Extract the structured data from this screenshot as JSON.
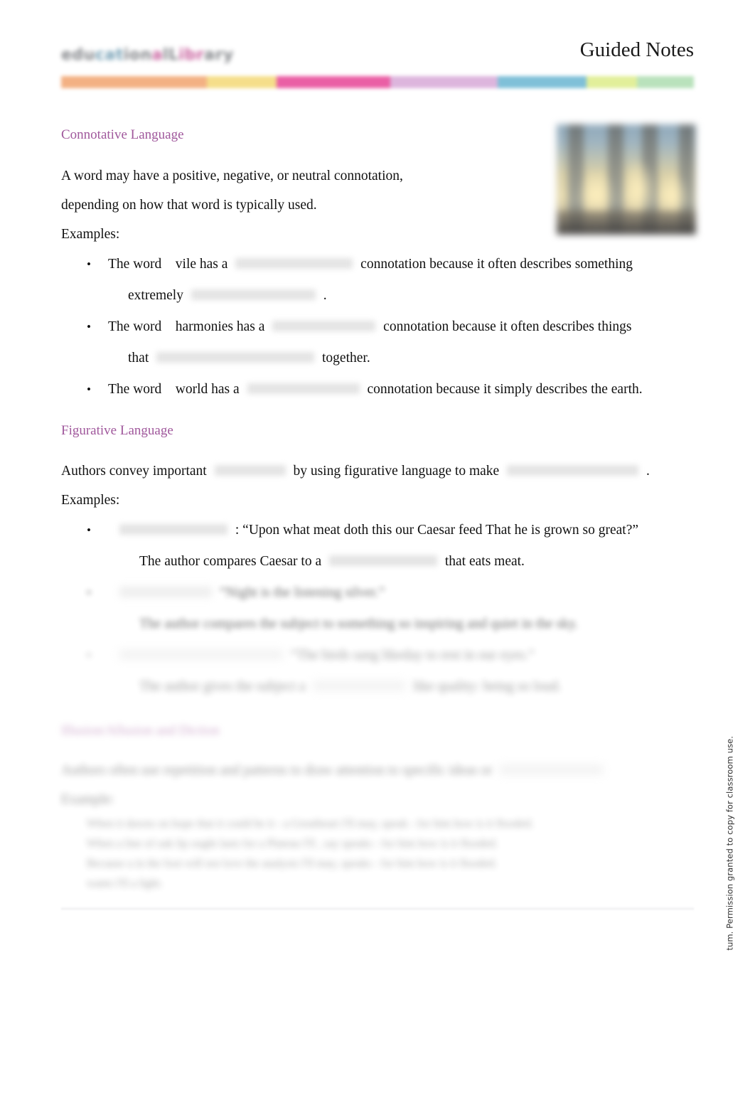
{
  "header": {
    "logo_text_parts": [
      "edu",
      "cat",
      "ion",
      "alL",
      "ibr",
      "ary"
    ],
    "logo_alt": "publisher-logo",
    "document_title": "Guided Notes",
    "colorbar": [
      {
        "name": "orange",
        "hex": "#f3b183",
        "width": 23
      },
      {
        "name": "yellow",
        "hex": "#f5de8a",
        "width": 11
      },
      {
        "name": "magenta",
        "hex": "#ea5fa5",
        "width": 18
      },
      {
        "name": "lavender",
        "hex": "#ddb5dd",
        "width": 17
      },
      {
        "name": "blue",
        "hex": "#7fc0d8",
        "width": 14
      },
      {
        "name": "lime",
        "hex": "#e2ef9a",
        "width": 8
      },
      {
        "name": "green",
        "hex": "#b9e2bc",
        "width": 9
      }
    ]
  },
  "hero_image": {
    "name": "columns-photo",
    "description": "Blurred photograph of classical stone columns against a blue sky with warm golden light"
  },
  "sections": [
    {
      "heading": "Connotative Language",
      "intro_line1": "A word may have a positive, negative, or neutral connotation,",
      "intro_line2": "depending on how that word is typically used.",
      "examples_label": "Examples:",
      "bullets": [
        {
          "part1": "The word",
          "word": "vile has a",
          "blank1_width": 165,
          "part2": "connotation because it often describes something",
          "cont_part1": "extremely",
          "blank2_width": 175,
          "cont_part2": "."
        },
        {
          "part1": "The word",
          "word": "harmonies   has a",
          "blank1_width": 145,
          "part2": "connotation because it often describes things",
          "cont_part1": "that",
          "blank2_width": 222,
          "cont_part2": "together."
        },
        {
          "part1": "The word",
          "word": "world  has a",
          "blank1_width": 158,
          "part2": "connotation because it simply describes the earth.",
          "cont_part1": "",
          "blank2_width": 0,
          "cont_part2": ""
        }
      ]
    },
    {
      "heading": "Figurative Language",
      "intro_part1": "Authors convey important",
      "intro_blank1_width": 100,
      "intro_part2": "by using figurative language to make",
      "intro_blank2_width": 185,
      "intro_part3": ".",
      "examples_label": "Examples:",
      "bullets": [
        {
          "blank_lead_width": 152,
          "text": ": “Upon what meat doth this our Caesar feed That he is grown so great?”",
          "cont_part1": "The author compares Caesar to a",
          "cont_blank_width": 152,
          "cont_part2": "that eats meat."
        },
        {
          "obscured": true,
          "blank_lead_width": 130,
          "text": "“Night is the listening silver.”",
          "cont_text": "The author compares the subject to something so inspiring and quiet in the sky."
        },
        {
          "obscured": true,
          "blank_lead_width": 230,
          "text": "“The birds sang likeday to rest in our eyes.”",
          "cont_part1": "The author gives the subject a",
          "cont_blank_width": 130,
          "cont_part2": "like quality: being so loud."
        }
      ]
    },
    {
      "obscured": true,
      "heading": "Illusion/Allusion and Diction",
      "intro_text": "Authors often use repetition and patterns to draw attention to specific ideas or",
      "intro_blank_width": 145,
      "examples_label": "Example:",
      "lines": [
        "When it dawns on hope that it could be it       - a Greatheart I'll may, speak   - for him how is it flooded.",
        "When a line of oak lip ought lasts for a Plateau I'll       ,  say   speaks   - for him how is it flooded.",
        "Because a    in the foot will not love the    analysis I'll may, speaks   - for him how is it flooded.",
        "wants I'll a light."
      ]
    }
  ],
  "side_note": "tum. Permission granted to copy for classroom use.",
  "footer": {
    "rule": true
  }
}
